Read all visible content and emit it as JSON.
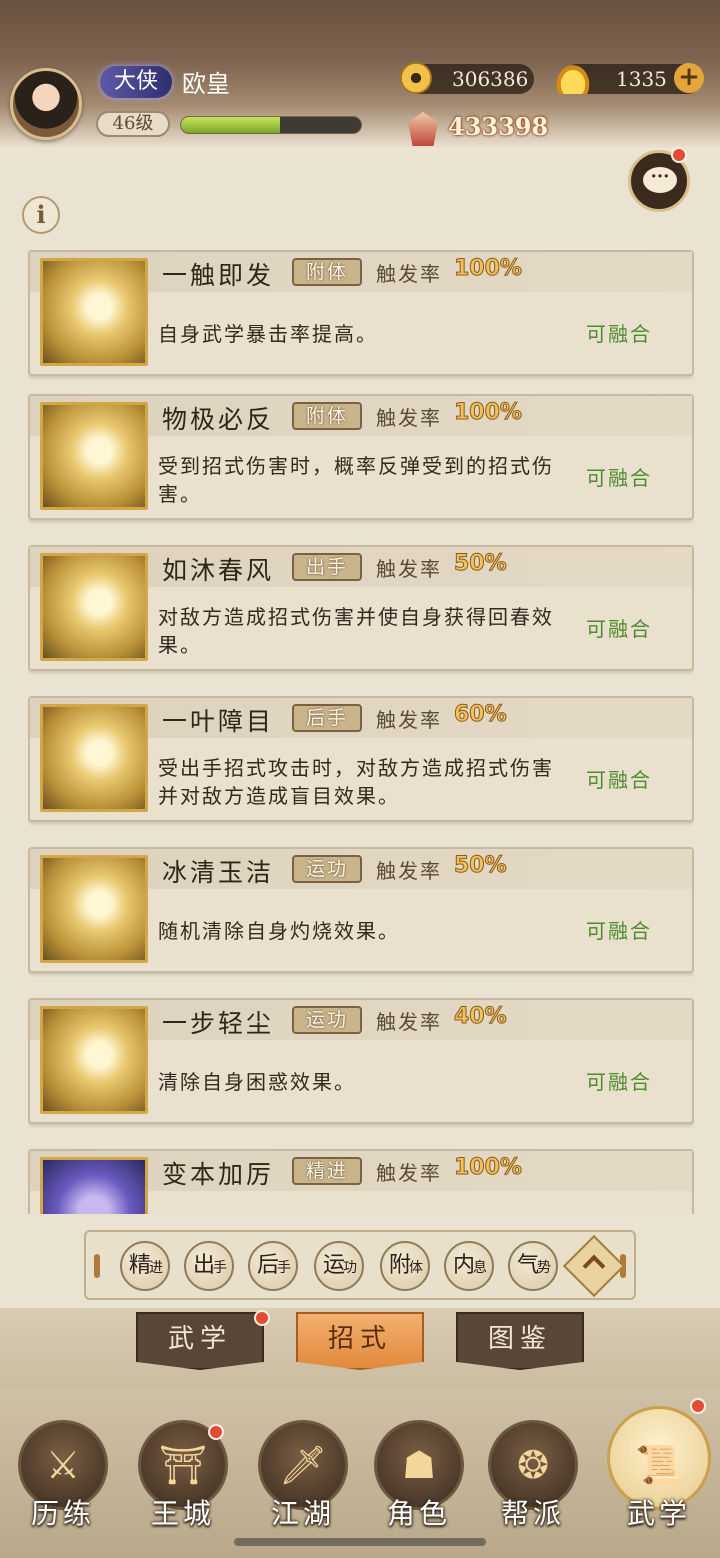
{
  "player": {
    "title": "大侠",
    "name": "欧皇",
    "level": "46级",
    "exp_progress": 0.55,
    "power": "433398"
  },
  "currency": {
    "coins": "306386",
    "ingots": "1335",
    "plus": "+"
  },
  "info_button": "i",
  "chat_button": "···",
  "trigger_label": "触发率",
  "fuse_label": "可融合",
  "skills": [
    {
      "name": "一触即发",
      "type": "附体",
      "rate": "100%",
      "desc": "自身武学暴击率提高。",
      "fuse": "可融合"
    },
    {
      "name": "物极必反",
      "type": "附体",
      "rate": "100%",
      "desc": "受到招式伤害时，概率反弹受到的招式伤害。",
      "fuse": "可融合"
    },
    {
      "name": "如沐春风",
      "type": "出手",
      "rate": "50%",
      "desc": "对敌方造成招式伤害并使自身获得回春效果。",
      "fuse": "可融合"
    },
    {
      "name": "一叶障目",
      "type": "后手",
      "rate": "60%",
      "desc": "受出手招式攻击时，对敌方造成招式伤害并对敌方造成盲目效果。",
      "fuse": "可融合"
    },
    {
      "name": "冰清玉洁",
      "type": "运功",
      "rate": "50%",
      "desc": "随机清除自身灼烧效果。",
      "fuse": "可融合"
    },
    {
      "name": "一步轻尘",
      "type": "运功",
      "rate": "40%",
      "desc": "清除自身困惑效果。",
      "fuse": "可融合"
    },
    {
      "name": "变本加厉",
      "type": "精进",
      "rate": "100%",
      "desc": "",
      "fuse": ""
    }
  ],
  "filters": [
    {
      "main": "精",
      "sub": "进"
    },
    {
      "main": "出",
      "sub": "手"
    },
    {
      "main": "后",
      "sub": "手"
    },
    {
      "main": "运",
      "sub": "功"
    },
    {
      "main": "附",
      "sub": "体"
    },
    {
      "main": "内",
      "sub": "息"
    },
    {
      "main": "气",
      "sub": "势"
    }
  ],
  "sub_tabs": {
    "wuxue": "武学",
    "zhaoshi": "招式",
    "tujian": "图鉴"
  },
  "nav": {
    "lilian": "历练",
    "wangcheng": "王城",
    "jianghu": "江湖",
    "juese": "角色",
    "bangpai": "帮派",
    "wuxue": "武学"
  },
  "colors": {
    "accent": "#e18a3c",
    "fuse_green": "#4f8a2e",
    "rate_gold": "#f3c05a",
    "notice_red": "#e34a38"
  }
}
